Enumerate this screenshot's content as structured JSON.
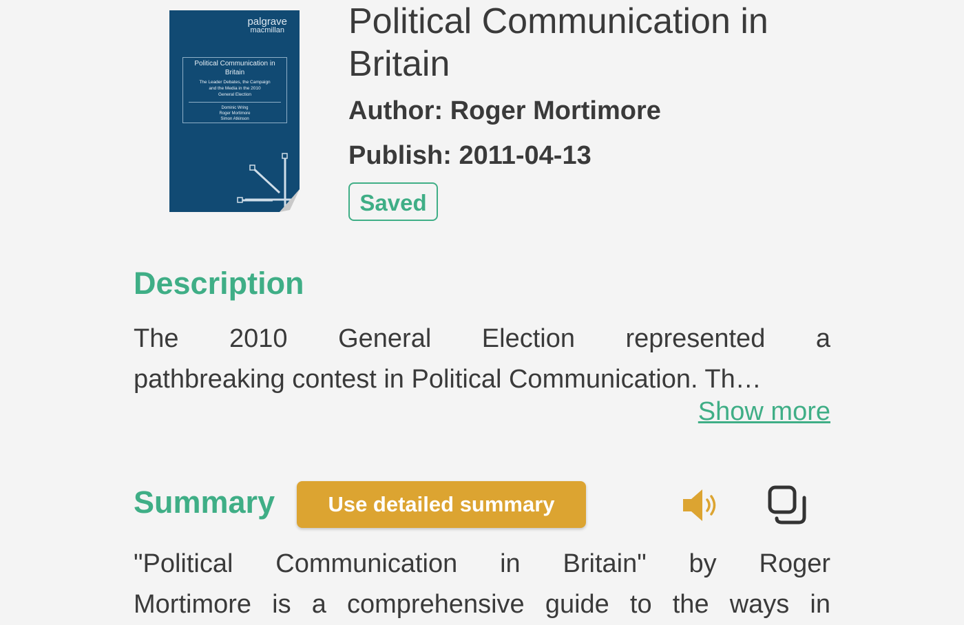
{
  "book": {
    "title": "Political Communication in Britain",
    "author": "Author: Roger Mortimore",
    "publish": "Publish: 2011-04-13",
    "saved_label": "Saved"
  },
  "cover": {
    "publisher_line1": "palgrave",
    "publisher_line2": "macmillan",
    "title_line1": "Political Communication in",
    "title_line2": "Britain",
    "subtitle_line1": "The Leader Debates, the Campaign",
    "subtitle_line2": "and the Media in the 2010",
    "subtitle_line3": "General Election",
    "editor1": "Dominic Wring",
    "editor2": "Roger Mortimore",
    "editor3": "Simon Atkinson",
    "background_color": "#114a73"
  },
  "description": {
    "heading": "Description",
    "line1": "The 2010 General Election represented a",
    "line2": "pathbreaking contest in Political Communication. Th…",
    "show_more_label": "Show more"
  },
  "summary": {
    "heading": "Summary",
    "detailed_button_label": "Use detailed summary",
    "line1": "\"Political Communication in Britain\" by Roger",
    "line2": "Mortimore is a comprehensive guide to the ways in",
    "speaker_icon": "speaker-icon",
    "copy_icon": "copy-icon"
  },
  "colors": {
    "accent_green": "#3fae86",
    "button_gold": "#dca431",
    "text": "#3a3a3a",
    "background": "#f4f4f4"
  }
}
